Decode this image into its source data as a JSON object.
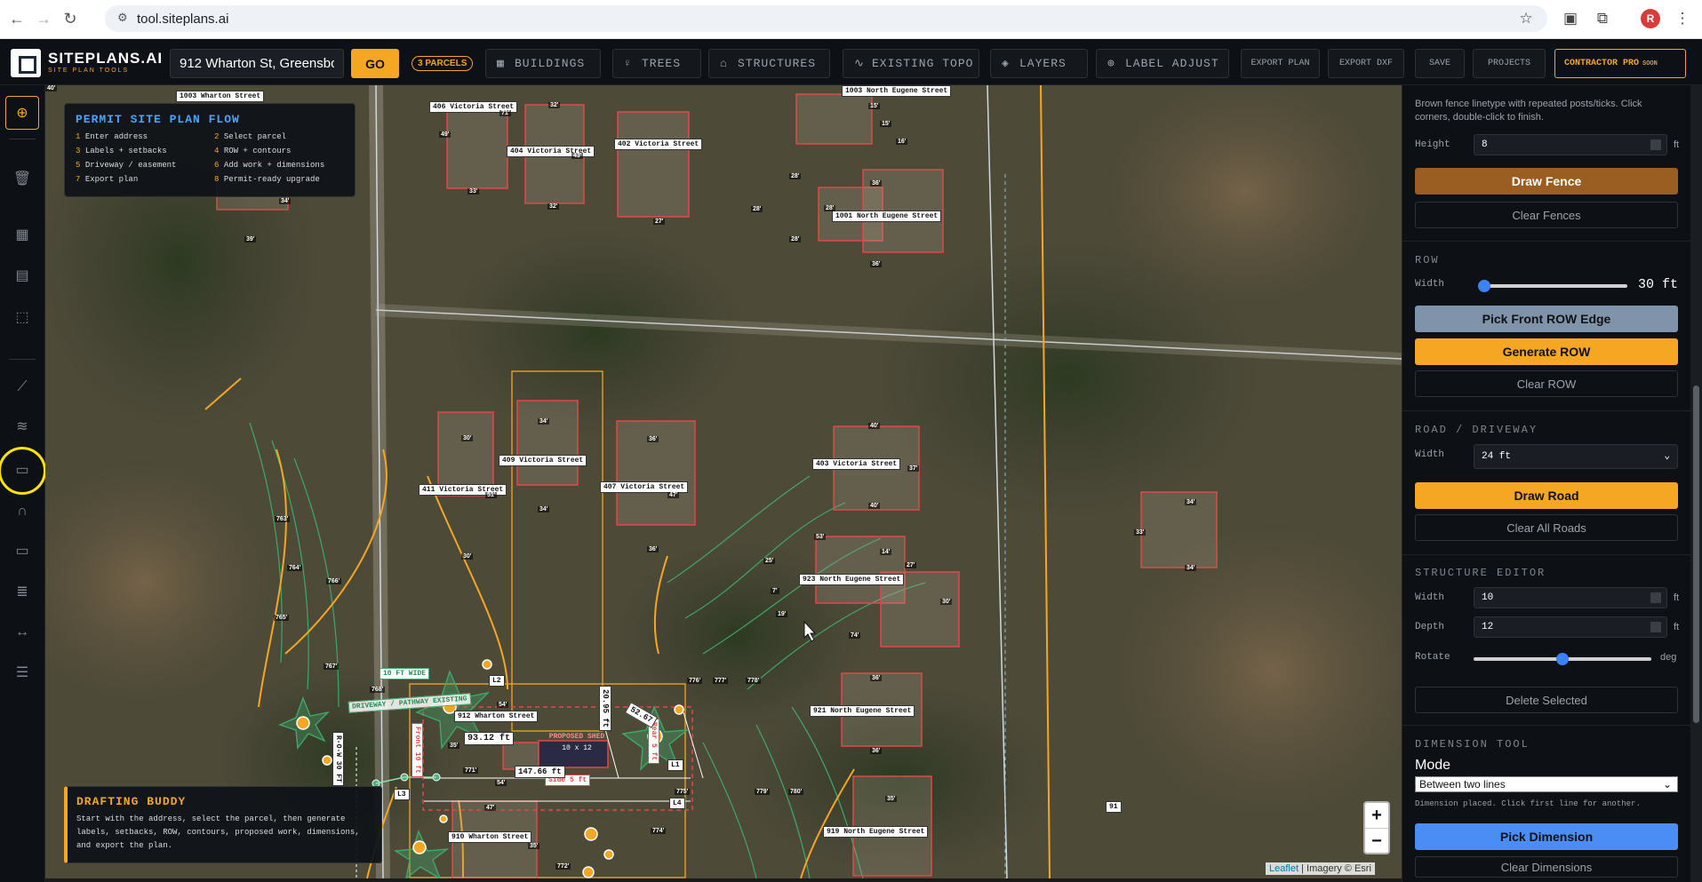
{
  "browser": {
    "url": "tool.siteplans.ai",
    "profile_initial": "R"
  },
  "toolbar": {
    "brand": "SITEPLANS.AI",
    "brand_sub": "SITE PLAN TOOLS",
    "address_value": "912 Wharton St, Greensbor",
    "go_label": "GO",
    "parcels_badge": "3 PARCELS",
    "buildings": "BUILDINGS",
    "trees": "TREES",
    "structures": "STRUCTURES",
    "existing_topo": "EXISTING TOPO",
    "layers": "LAYERS",
    "label_adjust": "LABEL ADJUST",
    "export_plan": "EXPORT PLAN",
    "export_dxf": "EXPORT DXF",
    "save": "SAVE",
    "projects": "PROJECTS",
    "contractor": "CONTRACTOR PRO",
    "contractor_soon": "SOON"
  },
  "flow": {
    "title": "PERMIT SITE PLAN FLOW",
    "steps": [
      {
        "n": "1",
        "t": "Enter address"
      },
      {
        "n": "2",
        "t": "Select parcel"
      },
      {
        "n": "3",
        "t": "Labels + setbacks"
      },
      {
        "n": "4",
        "t": "ROW + contours"
      },
      {
        "n": "5",
        "t": "Driveway / easement"
      },
      {
        "n": "6",
        "t": "Add work + dimensions"
      },
      {
        "n": "7",
        "t": "Export plan"
      },
      {
        "n": "8",
        "t": "Permit-ready upgrade"
      }
    ]
  },
  "buddy": {
    "title": "DRAFTING BUDDY",
    "text": "Start with the address, select the parcel, then generate labels, setbacks, ROW, contours, proposed work, dimensions, and export the plan."
  },
  "map": {
    "attribution_leaflet": "Leaflet",
    "attribution_rest": "| Imagery © Esri",
    "zoom_in": "+",
    "zoom_out": "−",
    "parcel_labels": {
      "p1003w": "1003 Wharton Street",
      "p406v": "406 Victoria Street",
      "p404v": "404 Victoria Street",
      "p402v": "402 Victoria Street",
      "p1003ne": "1003 North Eugene Street",
      "p1001ne": "1001 North Eugene Street",
      "p411v": "411 Victoria Street",
      "p409v": "409 Victoria Street",
      "p407v": "407 Victoria Street",
      "p403v": "403 Victoria Street",
      "p923ne": "923 North Eugene Street",
      "p921ne": "921 North Eugene Street",
      "p919ne": "919 North Eugene Street",
      "p912w": "912 Wharton Street",
      "p910w": "910 Wharton Street",
      "p91": "91"
    },
    "dims": {
      "d32a": "32'",
      "d71": "71'",
      "d49": "49'",
      "d33": "33'",
      "d43": "43'",
      "d32b": "32'",
      "d27": "27'",
      "d15a": "15'",
      "d15b": "15'",
      "d16": "16'",
      "d28a": "28'",
      "d28b": "28'",
      "d28c": "28'",
      "d28d": "28'",
      "d36a": "36'",
      "d36b": "36'",
      "d34a": "34'",
      "d39": "39'",
      "d30a": "30'",
      "d34b": "34'",
      "d40a": "40'",
      "d34c": "34'",
      "d36c": "36'",
      "d47a": "47'",
      "d36d": "36'",
      "d30b": "30'",
      "d51": "51'",
      "d40b": "40'",
      "d37": "37'",
      "d40c": "40'",
      "d53": "53'",
      "d14": "14'",
      "d25": "25'",
      "d27b": "27'",
      "d30c": "30'",
      "d7": "7'",
      "d19": "19'",
      "d74": "74'",
      "d36e": "36'",
      "d36f": "36'",
      "d35a": "35'",
      "d34d": "34'",
      "d33b": "33'",
      "d34e": "34'",
      "d54a": "54'",
      "d35b": "35'",
      "d54b": "54'",
      "d47b": "47'",
      "d35c": "35'",
      "d763": "763'",
      "d764": "764'",
      "d766": "766'",
      "d765": "765'",
      "d767": "767'",
      "d768": "768'",
      "d776": "776'",
      "d777": "777'",
      "d778": "778'",
      "d779": "779'",
      "d780": "780'",
      "d775": "775'",
      "d771": "771'",
      "d774": "774'",
      "d772": "772'"
    },
    "annot": {
      "ten_ft_wide": "10 FT WIDE",
      "driveway": "DRIVEWAY / PATHWAY EXISTING",
      "row30": "R-O-W 30 FT",
      "front10": "Front 10 ft",
      "rear5": "Rear 5 ft",
      "side5": "Side 5 ft",
      "proposed": "PROPOSED SHED",
      "proposed_size": "10 x 12",
      "d9312": "93.12 ft",
      "d14766": "147.66 ft",
      "d2095": "20.95 ft",
      "d5267": "52.67",
      "l1": "L1",
      "l2": "L2",
      "l3": "L3",
      "l4": "L4"
    }
  },
  "panel": {
    "fence_desc": "Brown fence linetype with repeated posts/ticks. Click corners, double-click to finish.",
    "height_label": "Height",
    "height_value": "8",
    "unit_ft": "ft",
    "draw_fence": "Draw Fence",
    "clear_fences": "Clear Fences",
    "row_head": "ROW",
    "width_label": "Width",
    "row_value": "30 ft",
    "row_fraction": 0.0,
    "pick_front_row": "Pick Front ROW Edge",
    "generate_row": "Generate ROW",
    "clear_row": "Clear ROW",
    "road_head": "ROAD / DRIVEWAY",
    "road_width": "24 ft",
    "draw_road": "Draw Road",
    "clear_roads": "Clear All Roads",
    "struct_head": "STRUCTURE EDITOR",
    "depth_label": "Depth",
    "rotate_label": "Rotate",
    "struct_width": "10",
    "struct_depth": "12",
    "deg": "deg",
    "rotate_fraction": 0.5,
    "delete_selected": "Delete Selected",
    "dim_head": "DIMENSION TOOL",
    "mode_label": "Mode",
    "mode_value": "Between two lines",
    "dim_note": "Dimension placed. Click first line for another.",
    "pick_dimension": "Pick Dimension",
    "clear_dimensions": "Clear Dimensions"
  },
  "colors": {
    "accent": "#f5a623",
    "parcel_outline": "#e04848",
    "contour": "#3fa86a",
    "link_blue": "#4aa3ff"
  }
}
